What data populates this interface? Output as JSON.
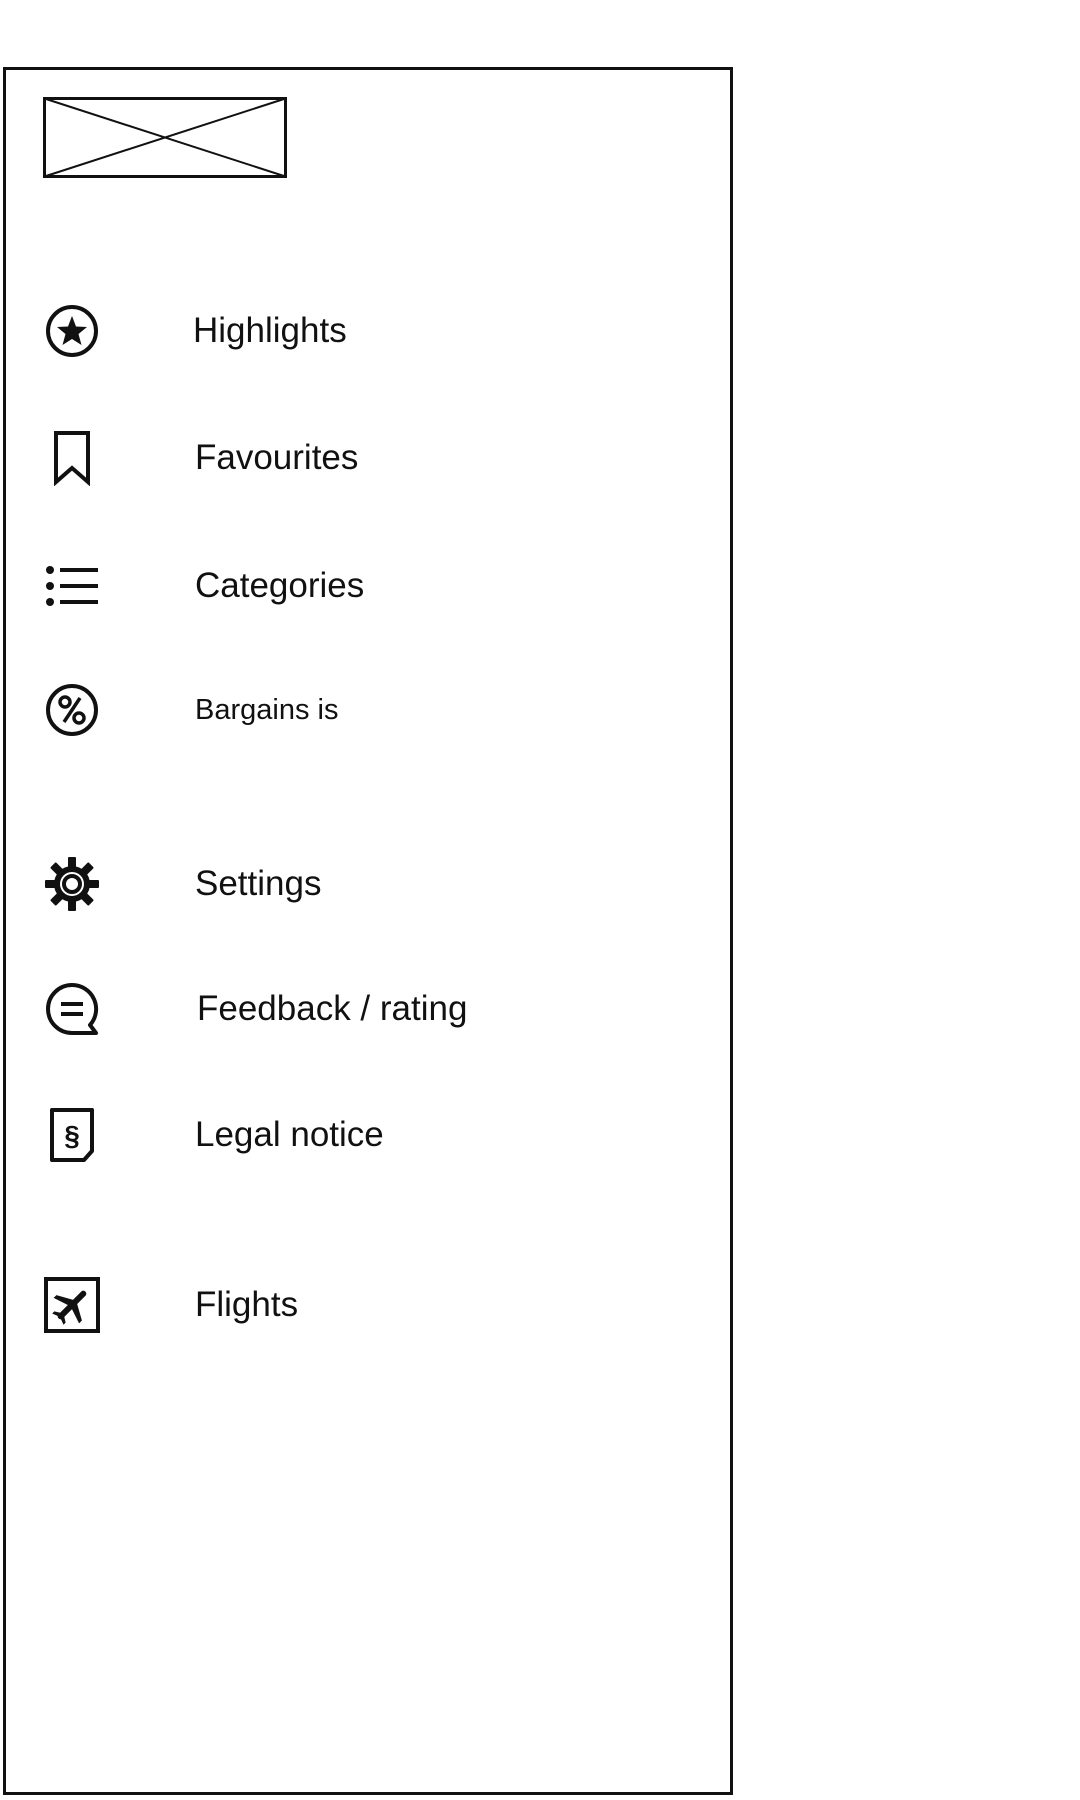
{
  "drawer": {
    "logo": {
      "icon": "image-placeholder-icon"
    },
    "items": [
      {
        "label": "Highlights",
        "icon": "star-circle-icon"
      },
      {
        "label": "Favourites",
        "icon": "bookmark-icon"
      },
      {
        "label": "Categories",
        "icon": "list-icon"
      },
      {
        "label": "Bargains is",
        "icon": "percent-circle-icon"
      },
      {
        "label": "Settings",
        "icon": "gear-icon"
      },
      {
        "label": "Feedback / rating",
        "icon": "chat-bubble-icon"
      },
      {
        "label": "Legal notice",
        "icon": "section-document-icon"
      },
      {
        "label": "Flights",
        "icon": "airplane-square-icon"
      }
    ]
  },
  "colors": {
    "stroke": "#111111",
    "background": "#ffffff"
  }
}
